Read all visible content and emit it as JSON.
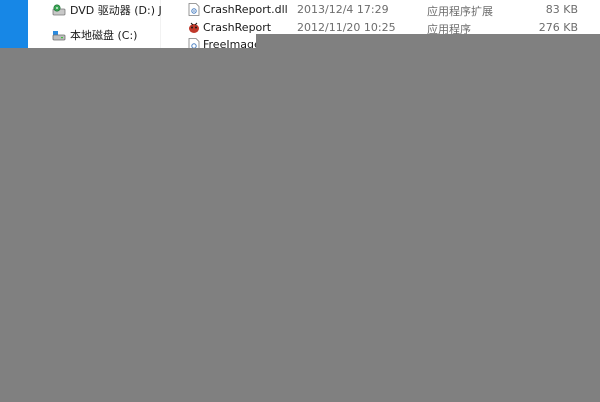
{
  "nav": {
    "items": [
      {
        "label": "DVD 驱动器 (D:) JN",
        "icon": "dvd-drive-icon"
      },
      {
        "label": "本地磁盘 (C:)",
        "icon": "local-disk-icon"
      }
    ]
  },
  "files": [
    {
      "name": "CrashReport.dll",
      "date": "2013/12/4 17:29",
      "type": "应用程序扩展",
      "size": "83 KB",
      "icon": "dll-file-icon"
    },
    {
      "name": "CrashReport",
      "date": "2012/11/20 10:25",
      "type": "应用程序",
      "size": "276 KB",
      "icon": "application-icon"
    },
    {
      "name": "FreeImage",
      "date": "",
      "type": "",
      "size": "",
      "icon": "dll-file-icon"
    }
  ],
  "colors": {
    "accent": "#1787e6",
    "overlay": "#808080"
  }
}
